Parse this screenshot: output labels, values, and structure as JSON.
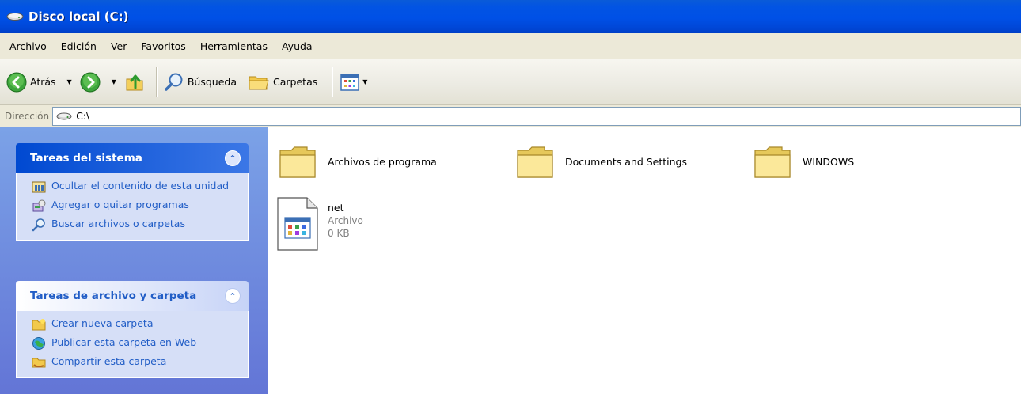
{
  "window": {
    "title": "Disco local (C:)"
  },
  "menu": [
    "Archivo",
    "Edición",
    "Ver",
    "Favoritos",
    "Herramientas",
    "Ayuda"
  ],
  "toolbar": {
    "back_label": "Atrás",
    "search_label": "Búsqueda",
    "folders_label": "Carpetas"
  },
  "address": {
    "label": "Dirección",
    "value": "C:\\"
  },
  "system_tasks": {
    "title": "Tareas del sistema",
    "items": [
      {
        "label": "Ocultar el contenido de esta unidad",
        "icon": "hide-drive-icon"
      },
      {
        "label": "Agregar o quitar programas",
        "icon": "add-remove-programs-icon"
      },
      {
        "label": "Buscar archivos o carpetas",
        "icon": "search-icon"
      }
    ]
  },
  "file_tasks": {
    "title": "Tareas de archivo y carpeta",
    "items": [
      {
        "label": "Crear nueva carpeta",
        "icon": "new-folder-icon"
      },
      {
        "label": "Publicar esta carpeta en Web",
        "icon": "publish-web-icon"
      },
      {
        "label": "Compartir esta carpeta",
        "icon": "share-folder-icon"
      }
    ]
  },
  "items": [
    {
      "name": "Archivos de programa",
      "type": "folder"
    },
    {
      "name": "Documents and Settings",
      "type": "folder"
    },
    {
      "name": "WINDOWS",
      "type": "folder"
    },
    {
      "name": "net",
      "type": "file",
      "type_label": "Archivo",
      "size": "0 KB"
    }
  ]
}
